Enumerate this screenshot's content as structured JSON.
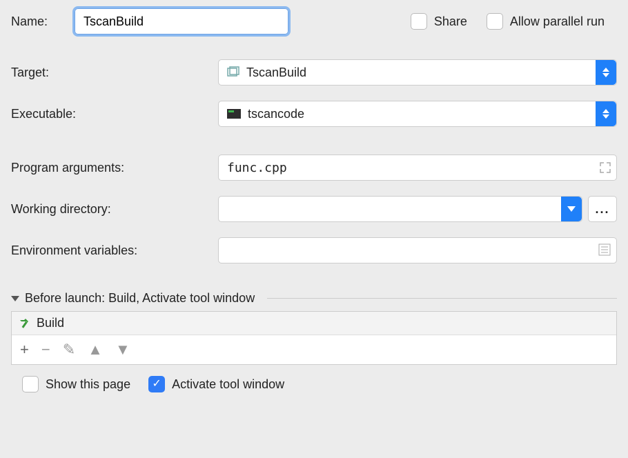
{
  "labels": {
    "name": "Name:",
    "target": "Target:",
    "executable": "Executable:",
    "program_arguments": "Program arguments:",
    "working_directory": "Working directory:",
    "environment_variables": "Environment variables:"
  },
  "values": {
    "name": "TscanBuild",
    "target": "TscanBuild",
    "executable": "tscancode",
    "program_arguments": "func.cpp",
    "working_directory": "",
    "environment_variables": ""
  },
  "checkboxes": {
    "share": {
      "label": "Share",
      "checked": false
    },
    "allow_parallel": {
      "label": "Allow parallel run",
      "checked": false
    },
    "show_this_page": {
      "label": "Show this page",
      "checked": false
    },
    "activate_tool_window": {
      "label": "Activate tool window",
      "checked": true
    }
  },
  "before_launch": {
    "header": "Before launch: Build, Activate tool window",
    "tasks": [
      {
        "label": "Build"
      }
    ]
  },
  "browse_label": "..."
}
